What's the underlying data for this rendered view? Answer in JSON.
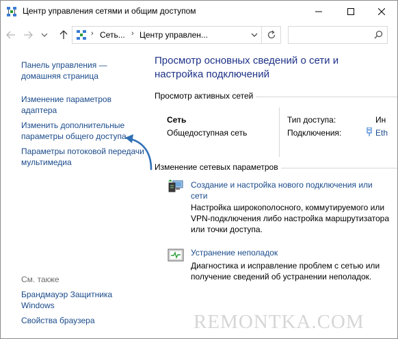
{
  "window": {
    "title": "Центр управления сетями и общим доступом",
    "controls": {
      "minimize": "minimize-icon",
      "maximize": "maximize-icon",
      "close": "close-icon"
    }
  },
  "navigation": {
    "breadcrumbs": [
      "Сеть...",
      "Центр управлен..."
    ],
    "search_placeholder": ""
  },
  "sidebar": {
    "links": [
      "Панель управления — домашняя страница",
      "Изменение параметров адаптера",
      "Изменить дополнительные параметры общего доступа",
      "Параметры потоковой передачи мультимедиа"
    ],
    "see_also_label": "См. также",
    "see_also_links": [
      "Брандмауэр Защитника Windows",
      "Свойства браузера"
    ]
  },
  "main": {
    "title": "Просмотр основных сведений о сети и настройка подключений",
    "active_networks": {
      "label": "Просмотр активных сетей",
      "network_name": "Сеть",
      "network_type": "Общедоступная сеть",
      "access_type_label": "Тип доступа:",
      "access_type_value": "Ин",
      "connections_label": "Подключения:",
      "connections_value": "Eth"
    },
    "change_settings": {
      "label": "Изменение сетевых параметров",
      "tasks": [
        {
          "link": "Создание и настройка нового подключения или сети",
          "description": "Настройка широкополосного, коммутируемого или VPN-подключения либо настройка маршрутизатора или точки доступа."
        },
        {
          "link": "Устранение неполадок",
          "description": "Диагностика и исправление проблем с сетью или получение сведений об устранении неполадок."
        }
      ]
    }
  },
  "watermark": "REMONTKA.COM",
  "colors": {
    "link": "#1a4a8a",
    "heading": "#1e3287",
    "arrow": "#2f6fb5",
    "muted": "#6d6d6d"
  }
}
